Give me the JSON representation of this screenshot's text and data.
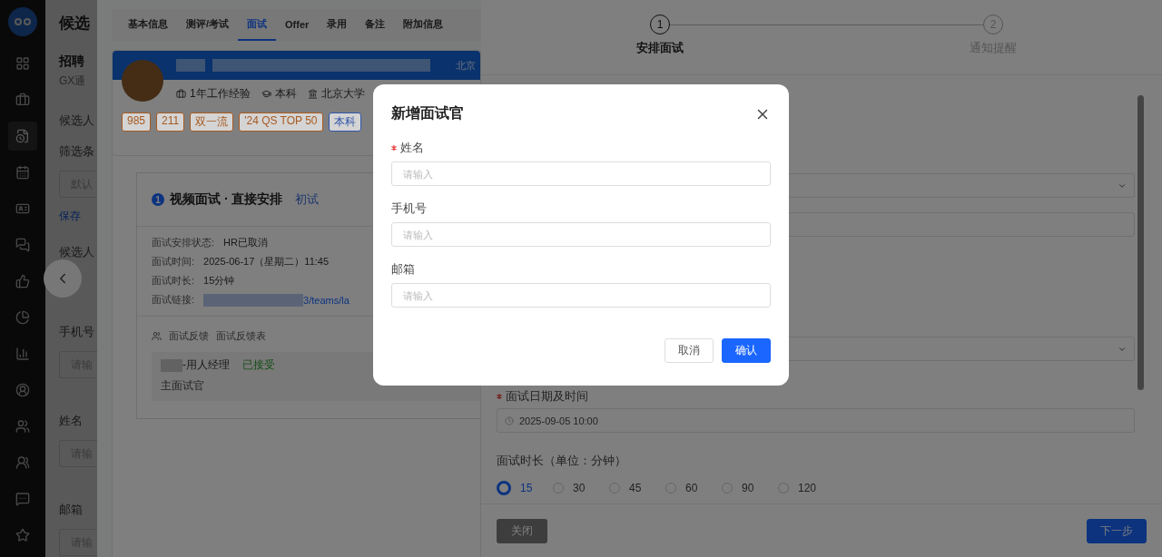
{
  "nav": {
    "items": [
      {
        "selected": false
      },
      {
        "selected": false
      },
      {
        "selected": true
      },
      {
        "selected": false
      },
      {
        "selected": false
      },
      {
        "selected": false
      },
      {
        "selected": false
      },
      {
        "selected": false
      },
      {
        "selected": false
      },
      {
        "selected": false
      },
      {
        "selected": false
      },
      {
        "selected": false
      },
      {
        "selected": false
      },
      {
        "selected": false
      }
    ]
  },
  "page": {
    "title": "候选",
    "section_title": "招聘",
    "section_subtitle": "GX通",
    "info_label": "候选人",
    "filter_label": "筛选条",
    "filter_value": "默认",
    "save_link": "保存",
    "related_label": "候选人",
    "fields": [
      {
        "label": "手机号",
        "placeholder": "请输"
      },
      {
        "label": "姓名",
        "placeholder": "请输"
      },
      {
        "label": "邮箱",
        "placeholder": "请输"
      }
    ]
  },
  "candidate_drawer": {
    "tabs": [
      {
        "label": "基本信息",
        "selected": false
      },
      {
        "label": "测评/考试",
        "selected": false
      },
      {
        "label": "面试",
        "selected": true
      },
      {
        "label": "Offer",
        "selected": false
      },
      {
        "label": "录用",
        "selected": false
      },
      {
        "label": "备注",
        "selected": false
      },
      {
        "label": "附加信息",
        "selected": false
      }
    ],
    "profile": {
      "location": "北京",
      "meta": [
        "1年工作经验",
        "本科",
        "北京大学"
      ],
      "tags": [
        {
          "label": "985",
          "color": "#a85a20"
        },
        {
          "label": "211",
          "color": "#a85a20"
        },
        {
          "label": "双一流",
          "color": "#a85a20"
        },
        {
          "label": "'24 QS TOP 50",
          "color": "#a85a20"
        },
        {
          "label": "本科",
          "color": "#2f55a8"
        }
      ]
    },
    "interview": {
      "number": "1",
      "title": "视频面试 · 直接安排",
      "round": "初试",
      "details": [
        {
          "kind": "text",
          "label": "面试安排状态:",
          "value": "HR已取消"
        },
        {
          "kind": "text",
          "label": "面试时间:",
          "value": "2025-06-17（星期二）11:45"
        },
        {
          "kind": "text",
          "label": "面试时长:",
          "value": "15分钟"
        },
        {
          "kind": "link",
          "label": "面试链接:",
          "value": "3/teams/la"
        }
      ],
      "feedback_label": "面试反馈",
      "feedback_form": "面试反馈表",
      "interviewer": {
        "role": "-用人经理",
        "status": "已接受",
        "type": "主面试官"
      }
    }
  },
  "schedule_drawer": {
    "steps": [
      {
        "number": "1",
        "label": "安排面试",
        "active": true
      },
      {
        "number": "2",
        "label": "通知提醒",
        "active": false
      }
    ],
    "fields": [
      {
        "kind": "select"
      },
      {
        "kind": "input"
      },
      {
        "kind": "select"
      }
    ],
    "datetime": {
      "label": "面试日期及时间",
      "required": true,
      "value": "2025-09-05 10:00"
    },
    "duration": {
      "label": "面试时长（单位：分钟）",
      "options": [
        {
          "label": "15",
          "selected": true
        },
        {
          "label": "30",
          "selected": false
        },
        {
          "label": "45",
          "selected": false
        },
        {
          "label": "60",
          "selected": false
        },
        {
          "label": "90",
          "selected": false
        },
        {
          "label": "120",
          "selected": false
        }
      ]
    },
    "close_button": "关闭",
    "next_button": "下一步"
  },
  "modal": {
    "title": "新增面试官",
    "fields": [
      {
        "label": "姓名",
        "required": true,
        "placeholder": "请输入"
      },
      {
        "label": "手机号",
        "required": false,
        "placeholder": "请输入"
      },
      {
        "label": "邮箱",
        "required": false,
        "placeholder": "请输入"
      }
    ],
    "cancel_button": "取消",
    "confirm_button": "确认"
  }
}
